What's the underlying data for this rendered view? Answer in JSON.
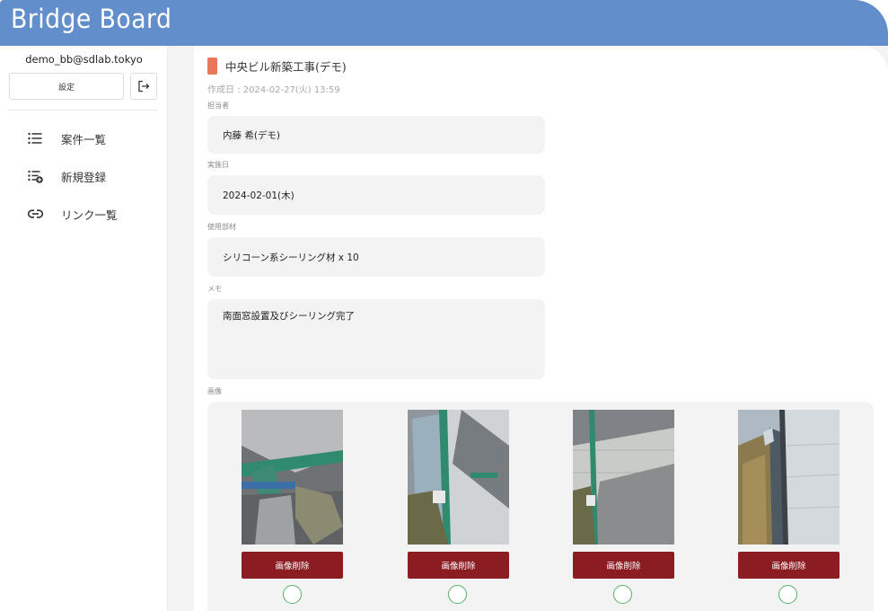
{
  "app": {
    "brand": "Bridge Board"
  },
  "sidebar": {
    "user_email": "demo_bb@sdlab.tokyo",
    "settings_label": "設定",
    "items": [
      {
        "label": "案件一覧",
        "icon": "list-icon"
      },
      {
        "label": "新規登録",
        "icon": "add-list-icon"
      },
      {
        "label": "リンク一覧",
        "icon": "link-icon"
      }
    ]
  },
  "record": {
    "title": "中央ビル新築工事(デモ)",
    "created": "作成日 : 2024-02-27(火) 13:59",
    "assignee_label": "担当者",
    "assignee": "内藤 希(デモ)",
    "date_label": "実施日",
    "date": "2024-02-01(木)",
    "materials_label": "使用部材",
    "materials": "シリコーン系シーリング材 x 10",
    "memo_label": "メモ",
    "memo": "南面窓設置及びシーリング完了",
    "images_label": "画像"
  },
  "images": [
    {
      "delete_label": "画像削除"
    },
    {
      "delete_label": "画像削除"
    },
    {
      "delete_label": "画像削除"
    },
    {
      "delete_label": "画像削除"
    }
  ],
  "colors": {
    "header": "#628ecb",
    "accent": "#e8785a",
    "delete_button": "#8b1c22",
    "radio": "#54b06b"
  }
}
